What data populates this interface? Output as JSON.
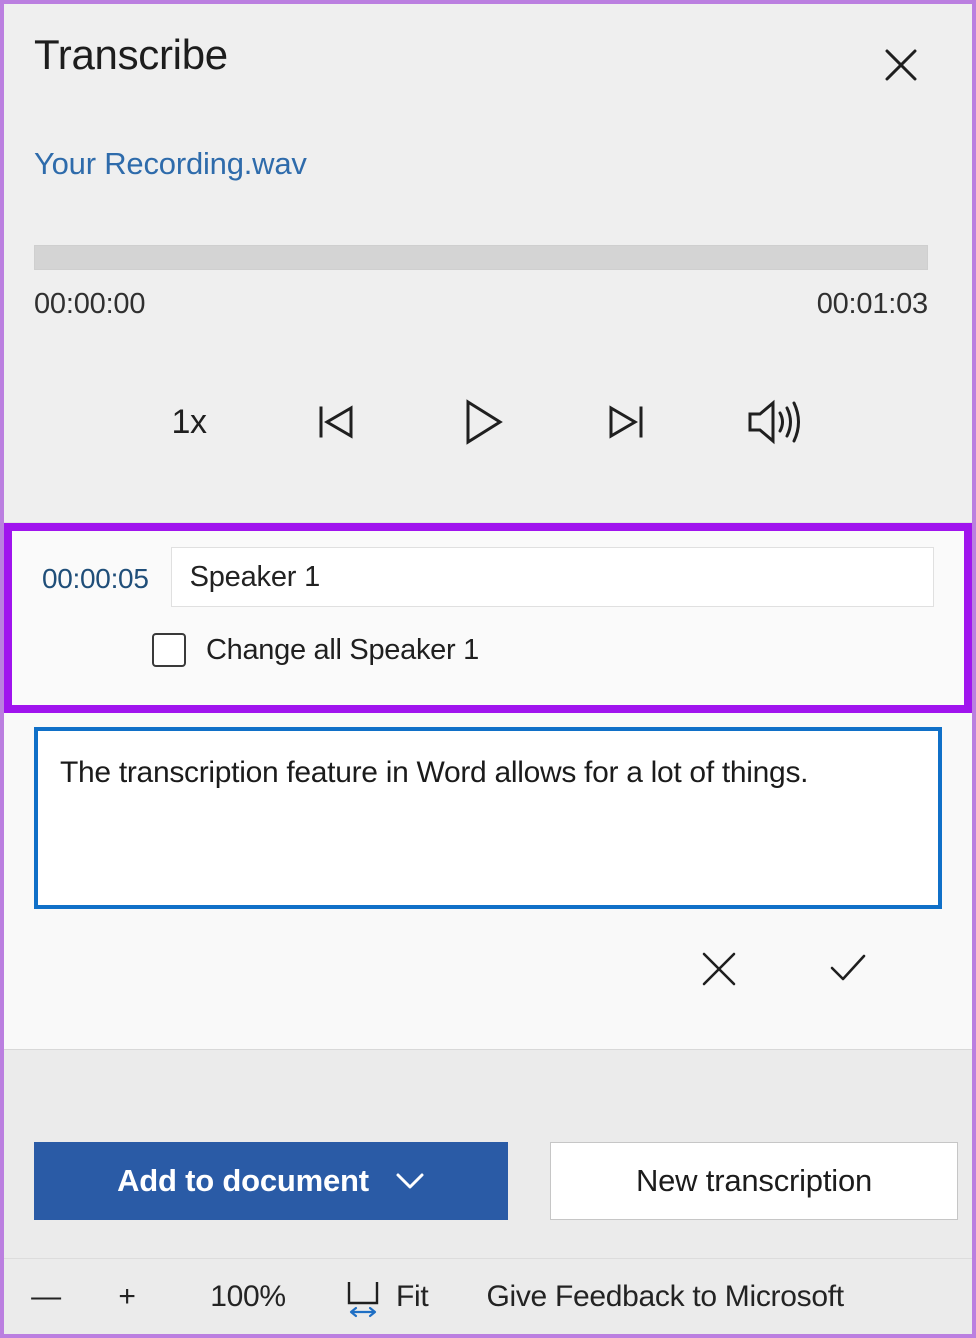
{
  "panel": {
    "title": "Transcribe",
    "close_icon": "close-icon"
  },
  "player": {
    "file_name": "Your Recording.wav",
    "progress_percent": 0,
    "time_current": "00:00:00",
    "time_total": "00:01:03",
    "controls": {
      "speed_label": "1x",
      "rewind_icon": "skip-back-icon",
      "play_icon": "play-icon",
      "forward_icon": "skip-forward-icon",
      "volume_icon": "volume-icon"
    }
  },
  "transcript": {
    "segment": {
      "timestamp": "00:00:05",
      "speaker_name": "Speaker 1",
      "speaker_placeholder": "Speaker 1",
      "change_all_label": "Change all Speaker 1",
      "change_all_checked": false,
      "text": "The transcription feature in Word allows for a lot of things.",
      "cancel_icon": "close-icon",
      "confirm_icon": "check-icon"
    }
  },
  "actions": {
    "add_to_document_label": "Add to document",
    "add_to_document_caret": "chevron-down-icon",
    "new_transcription_label": "New transcription"
  },
  "statusbar": {
    "zoom_out_label": "—",
    "zoom_in_label": "+",
    "zoom_level": "100%",
    "fit_label": "Fit",
    "feedback_label": "Give Feedback to Microsoft"
  },
  "colors": {
    "annotation_outer": "#bb7fe0",
    "annotation_highlight": "#a014ee",
    "editor_focus_border": "#1070c8",
    "primary_button": "#2a5ba6",
    "link_blue": "#2e6bab",
    "timestamp_blue": "#1f4e79",
    "panel_background": "#efefef"
  }
}
